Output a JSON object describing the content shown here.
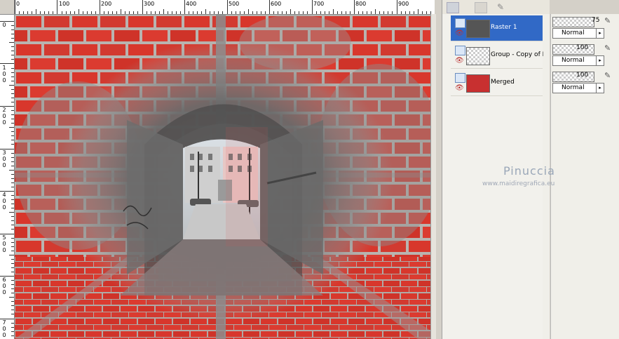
{
  "ruler": {
    "top_labels": [
      "0",
      "100",
      "200",
      "300",
      "400",
      "500",
      "600",
      "700",
      "800",
      "900"
    ],
    "left_labels": [
      [
        "0"
      ],
      [
        "1",
        "0",
        "0"
      ],
      [
        "2",
        "0",
        "0"
      ],
      [
        "3",
        "0",
        "0"
      ],
      [
        "4",
        "0",
        "0"
      ],
      [
        "5",
        "0",
        "0"
      ],
      [
        "6",
        "0",
        "0"
      ],
      [
        "7",
        "0",
        "0"
      ]
    ]
  },
  "layers": [
    {
      "name": "Raster 1",
      "opacity": "75",
      "blend": "Normal",
      "selected": true
    },
    {
      "name": "Group - Copy of M",
      "opacity": "100",
      "blend": "Normal",
      "selected": false
    },
    {
      "name": "Merged",
      "opacity": "100",
      "blend": "Normal",
      "selected": false
    }
  ],
  "watermark": {
    "name": "Pinuccia",
    "site": "www.maidiregrafica.eu"
  },
  "colors": {
    "brick_red": "#d8372c",
    "mortar": "#b9b4b0",
    "selection": "#3169c6"
  }
}
